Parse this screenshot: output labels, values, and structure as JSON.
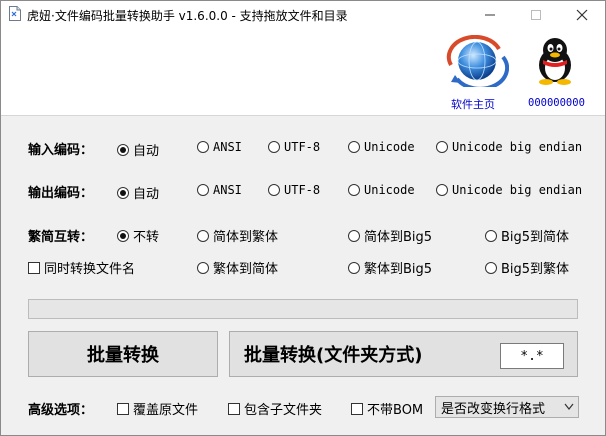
{
  "window": {
    "title": "虎妞·文件编码批量转换助手 v1.6.0.0 - 支持拖放文件和目录"
  },
  "header": {
    "home_link": "软件主页",
    "qq_link": "000000000"
  },
  "input_encoding": {
    "label": "输入编码：",
    "options": [
      "自动",
      "ANSI",
      "UTF-8",
      "Unicode",
      "Unicode big endian"
    ],
    "selected": "自动"
  },
  "output_encoding": {
    "label": "输出编码：",
    "options": [
      "自动",
      "ANSI",
      "UTF-8",
      "Unicode",
      "Unicode big endian"
    ],
    "selected": "自动"
  },
  "conversion": {
    "label": "繁简互转：",
    "row1": [
      "不转",
      "简体到繁体",
      "简体到Big5",
      "Big5到简体"
    ],
    "row2": [
      "繁体到简体",
      "繁体到Big5",
      "Big5到繁体"
    ],
    "selected": "不转",
    "rename_checkbox": "同时转换文件名",
    "rename_checked": false
  },
  "progress": {
    "value": 0
  },
  "actions": {
    "batch_convert": "批量转换",
    "folder_convert": "批量转换(文件夹方式)",
    "file_pattern": "*.*"
  },
  "advanced": {
    "label": "高级选项：",
    "overwrite": "覆盖原文件",
    "include_subfolders": "包含子文件夹",
    "no_bom": "不带BOM",
    "line_ending_select": "是否改变换行格式"
  }
}
